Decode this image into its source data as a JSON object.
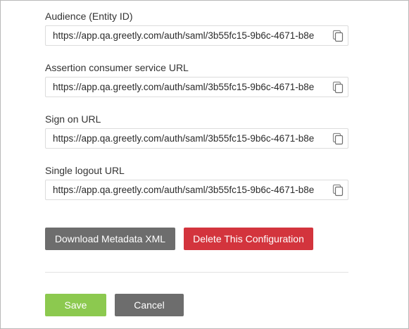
{
  "fields": [
    {
      "label": "Audience (Entity ID)",
      "value": "https://app.qa.greetly.com/auth/saml/3b55fc15-9b6c-4671-b8e"
    },
    {
      "label": "Assertion consumer service URL",
      "value": "https://app.qa.greetly.com/auth/saml/3b55fc15-9b6c-4671-b8e"
    },
    {
      "label": "Sign on URL",
      "value": "https://app.qa.greetly.com/auth/saml/3b55fc15-9b6c-4671-b8e"
    },
    {
      "label": "Single logout URL",
      "value": "https://app.qa.greetly.com/auth/saml/3b55fc15-9b6c-4671-b8e"
    }
  ],
  "copy_icon": "copy-icon",
  "actions": {
    "download_label": "Download Metadata XML",
    "delete_label": "Delete This Configuration"
  },
  "footer": {
    "save_label": "Save",
    "cancel_label": "Cancel"
  },
  "colors": {
    "gray_button": "#6d6d6d",
    "danger_button": "#d3343d",
    "save_button": "#8cc94f"
  }
}
